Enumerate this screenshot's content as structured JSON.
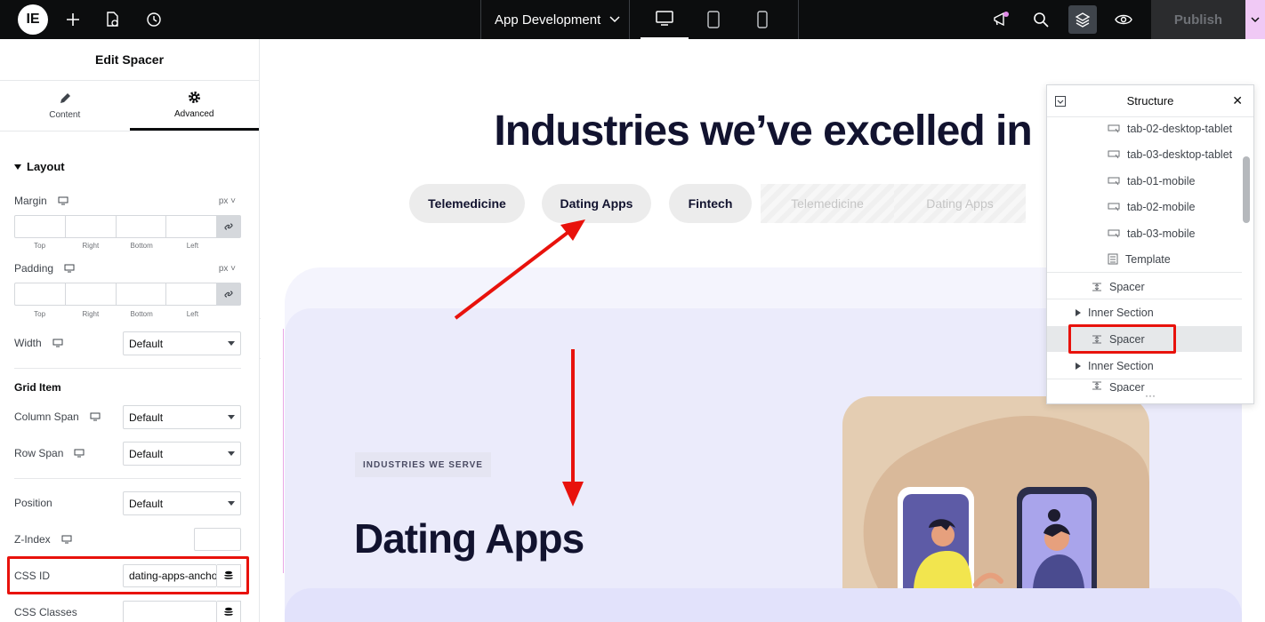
{
  "topbar": {
    "logo_text": "IE",
    "title": "App Development",
    "publish_label": "Publish",
    "icons": [
      "plus-icon",
      "page-settings-icon",
      "history-icon",
      "chevron-down-icon",
      "desktop-icon",
      "tablet-icon",
      "mobile-icon",
      "megaphone-icon",
      "search-icon",
      "layers-icon",
      "eye-icon"
    ]
  },
  "panel": {
    "title": "Edit Spacer",
    "tabs": [
      {
        "label": "Content",
        "icon": "pencil-icon"
      },
      {
        "label": "Advanced",
        "icon": "gear-icon"
      }
    ],
    "section_layout": "Layout",
    "margin": {
      "label": "Margin",
      "unit": "px",
      "sides": [
        "Top",
        "Right",
        "Bottom",
        "Left"
      ]
    },
    "padding": {
      "label": "Padding",
      "unit": "px",
      "sides": [
        "Top",
        "Right",
        "Bottom",
        "Left"
      ]
    },
    "width": {
      "label": "Width",
      "value": "Default"
    },
    "grid_item": "Grid Item",
    "column_span": {
      "label": "Column Span",
      "value": "Default"
    },
    "row_span": {
      "label": "Row Span",
      "value": "Default"
    },
    "position": {
      "label": "Position",
      "value": "Default"
    },
    "z_index": {
      "label": "Z-Index",
      "value": ""
    },
    "css_id": {
      "label": "CSS ID",
      "value": "dating-apps-ancho"
    },
    "css_classes": {
      "label": "CSS Classes",
      "value": ""
    }
  },
  "canvas": {
    "heading": "Industries we’ve excelled in",
    "pills": [
      "Telemedicine",
      "Dating Apps",
      "Fintech"
    ],
    "ghost_pills": [
      "Telemedicine",
      "Dating Apps"
    ],
    "badge": "INDUSTRIES WE SERVE",
    "section_title": "Dating Apps"
  },
  "structure": {
    "title": "Structure",
    "items": [
      {
        "label": "tab-02-desktop-tablet",
        "icon": "widget-icon"
      },
      {
        "label": "tab-03-desktop-tablet",
        "icon": "widget-icon"
      },
      {
        "label": "tab-01-mobile",
        "icon": "widget-icon"
      },
      {
        "label": "tab-02-mobile",
        "icon": "widget-icon"
      },
      {
        "label": "tab-03-mobile",
        "icon": "widget-icon"
      },
      {
        "label": "Template",
        "icon": "template-icon"
      },
      {
        "label": "Spacer",
        "icon": "spacer-icon"
      },
      {
        "label": "Inner Section",
        "icon": "caret-right-icon"
      },
      {
        "label": "Spacer",
        "icon": "spacer-icon",
        "selected": true
      },
      {
        "label": "Inner Section",
        "icon": "caret-right-icon"
      },
      {
        "label": "Spacer",
        "icon": "spacer-icon"
      }
    ]
  },
  "colors": {
    "accent_red": "#e8120c",
    "topbar": "#0c0d0e",
    "heading": "#12132f"
  }
}
